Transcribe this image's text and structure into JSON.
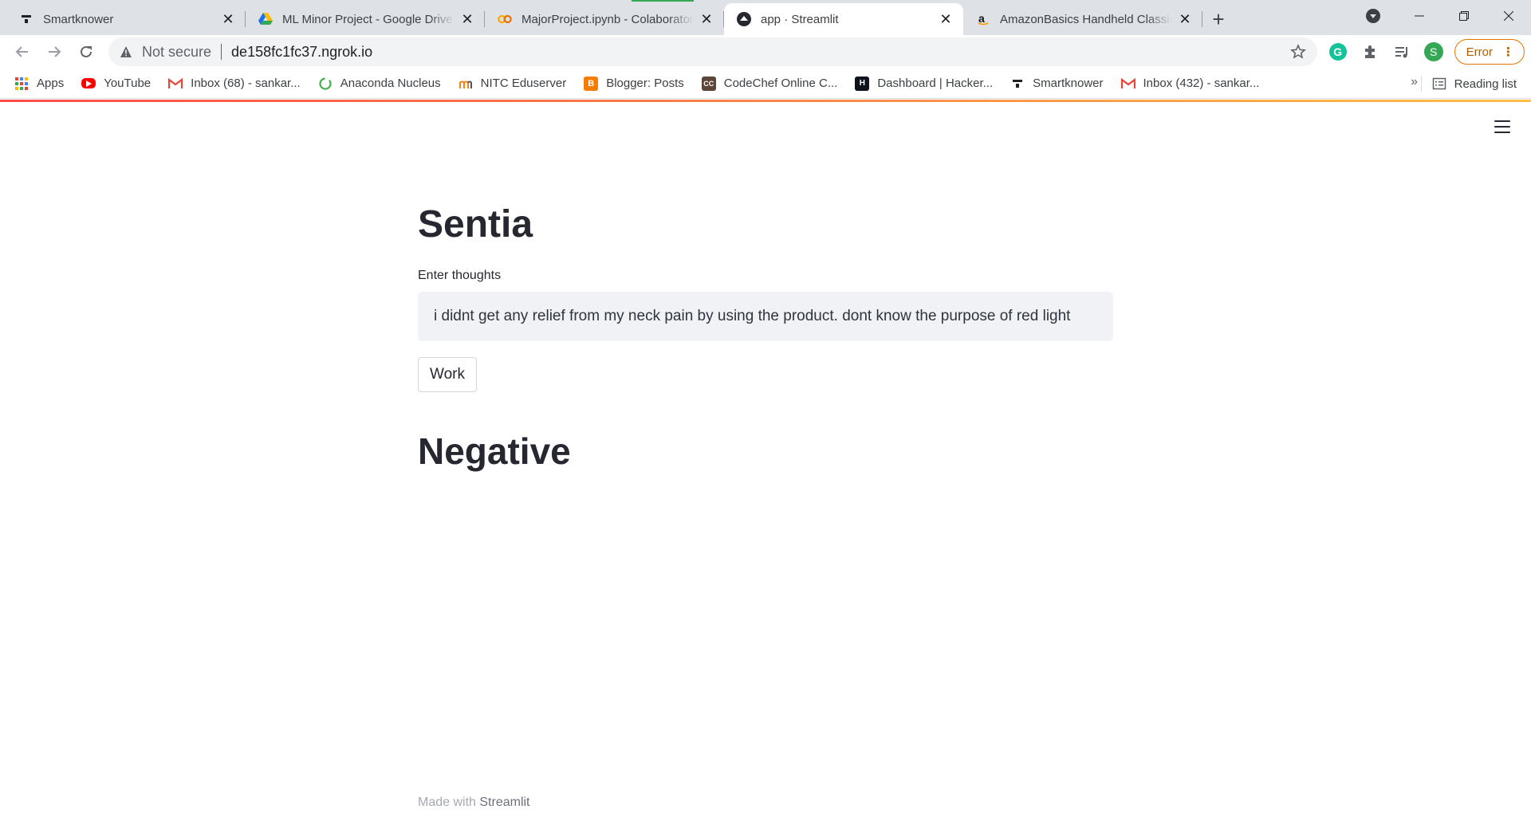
{
  "browser": {
    "tabs": [
      {
        "title": "Smartknower",
        "icon": "smartknower-icon",
        "active": false
      },
      {
        "title": "ML Minor Project - Google Drive",
        "icon": "google-drive-icon",
        "active": false
      },
      {
        "title": "MajorProject.ipynb - Colaboratory",
        "icon": "colab-icon",
        "active": false
      },
      {
        "title": "app · Streamlit",
        "icon": "streamlit-icon",
        "active": true
      },
      {
        "title": "AmazonBasics Handheld Classic Massager",
        "icon": "amazon-icon",
        "active": false
      }
    ],
    "address_bar": {
      "security_label": "Not secure",
      "url": "de158fc1fc37.ngrok.io"
    },
    "profile_initial": "S",
    "grammarly_initial": "G",
    "error_label": "Error",
    "bookmarks": [
      {
        "label": "Apps",
        "icon": "apps-grid-icon"
      },
      {
        "label": "YouTube",
        "icon": "youtube-icon"
      },
      {
        "label": "Inbox (68) - sankar...",
        "icon": "gmail-icon"
      },
      {
        "label": "Anaconda Nucleus",
        "icon": "anaconda-icon"
      },
      {
        "label": "NITC Eduserver",
        "icon": "moodle-icon"
      },
      {
        "label": "Blogger: Posts",
        "icon": "blogger-icon"
      },
      {
        "label": "CodeChef Online C...",
        "icon": "codechef-icon"
      },
      {
        "label": "Dashboard | Hacker...",
        "icon": "hackerrank-icon"
      },
      {
        "label": "Smartknower",
        "icon": "smartknower-icon"
      },
      {
        "label": "Inbox (432) - sankar...",
        "icon": "gmail-icon"
      }
    ],
    "bookmarks_overflow": "»",
    "reading_list_label": "Reading list"
  },
  "app": {
    "title": "Sentia",
    "input_label": "Enter thoughts",
    "input_value": "i didnt get any relief from my neck pain by using the product. dont know the purpose of red light",
    "button_label": "Work",
    "result": "Negative",
    "footer_prefix": "Made with",
    "footer_brand": "Streamlit"
  }
}
